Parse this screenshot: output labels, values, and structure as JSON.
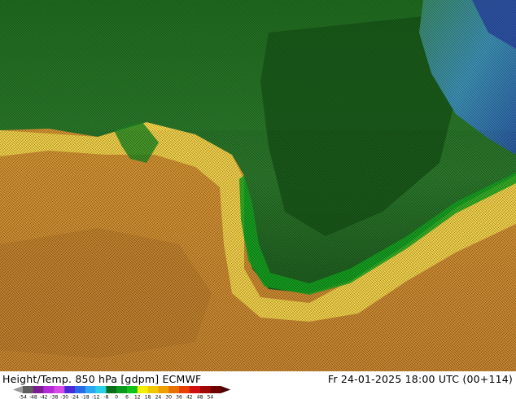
{
  "map": {
    "product_label": "Height/Temp. 850 hPa [gdpm] ECMWF",
    "valid_time": "Fr 24-01-2025 18:00 UTC (00+114)"
  },
  "legend": {
    "tick_labels": [
      "-54",
      "-48",
      "-42",
      "-38",
      "-30",
      "-24",
      "-18",
      "-12",
      "-8",
      "0",
      "6",
      "12",
      "18",
      "24",
      "30",
      "36",
      "42",
      "48",
      "54"
    ],
    "colors": [
      "#5e5e5e",
      "#7d1d94",
      "#b42ad6",
      "#d64ae8",
      "#4a2ad6",
      "#2a6ae8",
      "#2aa8f0",
      "#2ad0e8",
      "#0a6e18",
      "#0a9a1e",
      "#12c01a",
      "#f0f000",
      "#f0c800",
      "#f0a000",
      "#e87000",
      "#e84000",
      "#d01010",
      "#a00808",
      "#700000"
    ]
  }
}
